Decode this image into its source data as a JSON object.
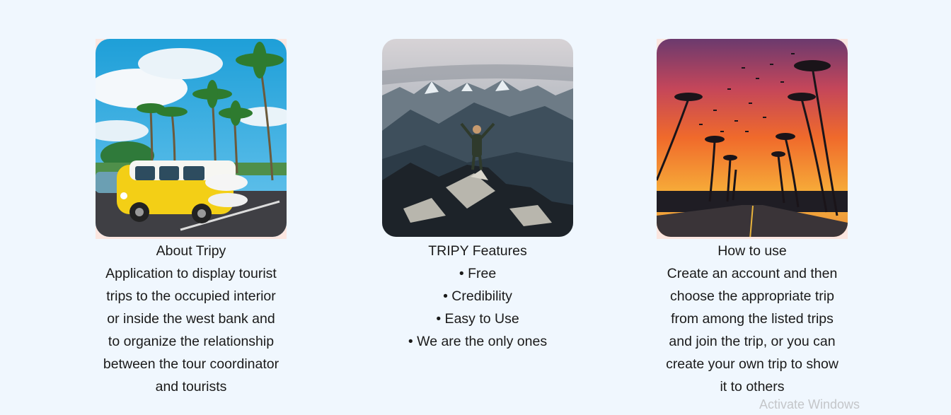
{
  "cards": [
    {
      "title": "About Tripy",
      "lines": [
        "Application to display tourist",
        "trips to the occupied interior",
        "or inside the west bank and",
        "to organize the relationship",
        "between the tour coordinator",
        "and tourists"
      ]
    },
    {
      "title": "TRIPY Features",
      "lines": [
        "• Free",
        "• Credibility",
        "• Easy to Use",
        "• We are the only ones"
      ]
    },
    {
      "title": "How to use",
      "lines": [
        "Create an account and then",
        "choose the appropriate trip",
        "from among the listed trips",
        "and join the trip, or you can",
        "create your own trip to show",
        "it to others"
      ]
    }
  ],
  "watermark": "Activate Windows",
  "colors": {
    "page_background": "#f0f7fe",
    "text": "#1a1a1a",
    "watermark": "#c4c6c9"
  }
}
